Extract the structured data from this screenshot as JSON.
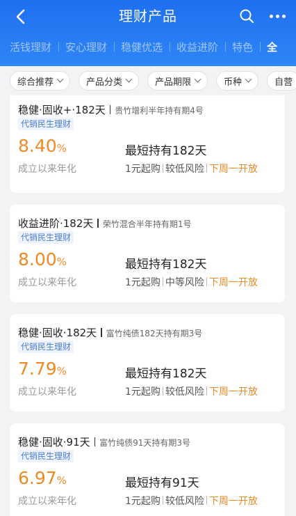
{
  "header": {
    "title": "理财产品",
    "tabs": [
      {
        "label": "活钱理财"
      },
      {
        "label": "安心理财"
      },
      {
        "label": "稳健优选"
      },
      {
        "label": "收益进阶"
      },
      {
        "label": "特色"
      },
      {
        "label": "全"
      }
    ]
  },
  "filters": [
    {
      "label": "综合推荐"
    },
    {
      "label": "产品分类"
    },
    {
      "label": "产品期限"
    },
    {
      "label": "币种"
    },
    {
      "label": "自营"
    }
  ],
  "products": [
    {
      "title": "稳健·固收+·182天",
      "name": "贵竹增利半年持有期4号",
      "tag": "代销民生理财",
      "rate": "8.40",
      "rate_unit": "%",
      "rate_label": "成立以来年化",
      "hold": "最短持有182天",
      "min": "1元起购",
      "risk": "较低风险",
      "open": "下周一开放"
    },
    {
      "title": "收益进阶·182天",
      "name": "荣竹混合半年持有期1号",
      "tag": "代销民生理财",
      "rate": "8.00",
      "rate_unit": "%",
      "rate_label": "成立以来年化",
      "hold": "最短持有182天",
      "min": "1元起购",
      "risk": "中等风险",
      "open": "下周一开放"
    },
    {
      "title": "稳健·固收·182天",
      "name": "富竹纯债182天持有期3号",
      "tag": "代销民生理财",
      "rate": "7.79",
      "rate_unit": "%",
      "rate_label": "成立以来年化",
      "hold": "最短持有182天",
      "min": "1元起购",
      "risk": "较低风险",
      "open": "下周一开放"
    },
    {
      "title": "稳健·固收·91天",
      "name": "富竹纯债91天持有期3号",
      "tag": "代销民生理财",
      "rate": "6.97",
      "rate_unit": "%",
      "rate_label": "成立以来年化",
      "hold": "最短持有91天",
      "min": "1元起购",
      "risk": "较低风险",
      "open": "下周一开放"
    }
  ]
}
